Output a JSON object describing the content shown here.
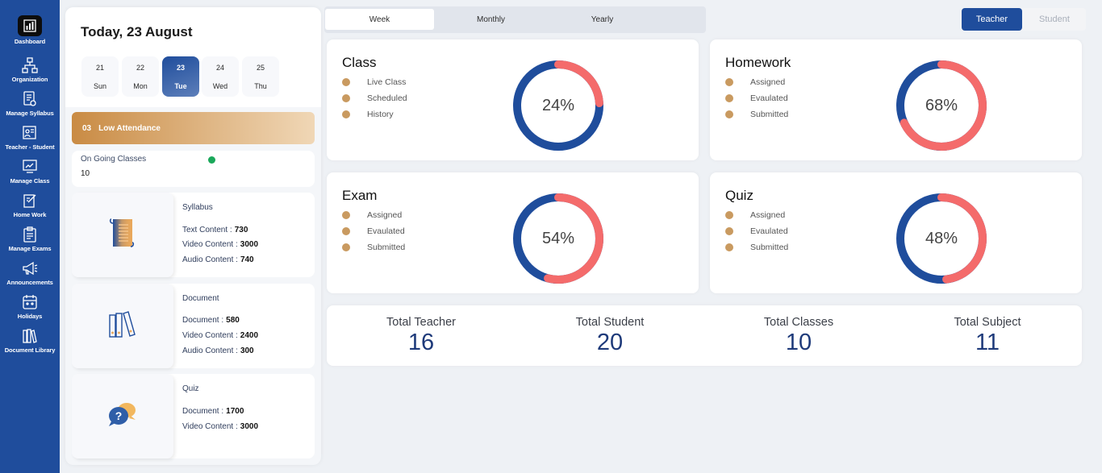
{
  "sidebar": {
    "items": [
      {
        "label": "Dashboard",
        "icon": "dashboard-icon"
      },
      {
        "label": "Organization",
        "icon": "organization-icon"
      },
      {
        "label": "Manage Syllabus",
        "icon": "syllabus-icon"
      },
      {
        "label": "Teacher - Student",
        "icon": "teacher-student-icon"
      },
      {
        "label": "Manage Class",
        "icon": "class-icon"
      },
      {
        "label": "Home Work",
        "icon": "homework-icon"
      },
      {
        "label": "Manage Exams",
        "icon": "exams-icon"
      },
      {
        "label": "Announcements",
        "icon": "megaphone-icon"
      },
      {
        "label": "Holidays",
        "icon": "calendar-icon"
      },
      {
        "label": "Document Library",
        "icon": "library-icon"
      }
    ]
  },
  "calendar": {
    "today": "Today, 23 August",
    "days": [
      {
        "num": "21",
        "name": "Sun"
      },
      {
        "num": "22",
        "name": "Mon"
      },
      {
        "num": "23",
        "name": "Tue"
      },
      {
        "num": "24",
        "name": "Wed"
      },
      {
        "num": "25",
        "name": "Thu"
      }
    ]
  },
  "low_attendance": {
    "count": "03",
    "label": "Low Attendance"
  },
  "ongoing": {
    "label": "On Going Classes",
    "value": "10"
  },
  "resources": {
    "syllabus": {
      "title": "Syllabus",
      "lines": [
        {
          "label": "Text Content :",
          "value": "730"
        },
        {
          "label": "Video Content :",
          "value": "3000"
        },
        {
          "label": "Audio Content :",
          "value": "740"
        }
      ]
    },
    "document": {
      "title": "Document",
      "lines": [
        {
          "label": "Document :",
          "value": "580"
        },
        {
          "label": "Video Content :",
          "value": "2400"
        },
        {
          "label": "Audio Content :",
          "value": "300"
        }
      ]
    },
    "quiz": {
      "title": "Quiz",
      "lines": [
        {
          "label": "Document :",
          "value": "1700"
        },
        {
          "label": "Video Content :",
          "value": "3000"
        }
      ]
    }
  },
  "period_tabs": [
    "Week",
    "Monthly",
    "Yearly"
  ],
  "role_tabs": [
    "Teacher",
    "Student"
  ],
  "stats": {
    "class": {
      "title": "Class",
      "legend": [
        "Live Class",
        "Scheduled",
        "History"
      ],
      "percent_label": "24%",
      "percent": 24
    },
    "homework": {
      "title": "Homework",
      "legend": [
        "Assigned",
        "Evaulated",
        "Submitted"
      ],
      "percent_label": "68%",
      "percent": 68
    },
    "exam": {
      "title": "Exam",
      "legend": [
        "Assigned",
        "Evaulated",
        "Submitted"
      ],
      "percent_label": "54%",
      "percent": 54
    },
    "quiz": {
      "title": "Quiz",
      "legend": [
        "Assigned",
        "Evaulated",
        "Submitted"
      ],
      "percent_label": "48%",
      "percent": 48
    }
  },
  "totals": [
    {
      "label": "Total Teacher",
      "value": "16"
    },
    {
      "label": "Total Student",
      "value": "20"
    },
    {
      "label": "Total Classes",
      "value": "10"
    },
    {
      "label": "Total Subject",
      "value": "11"
    }
  ],
  "colors": {
    "primary": "#1f4d9c",
    "ring_primary": "#1f4d9c",
    "ring_accent": "#f46b6b",
    "legend_dot": "#c99a60",
    "online": "#1aa85a"
  }
}
